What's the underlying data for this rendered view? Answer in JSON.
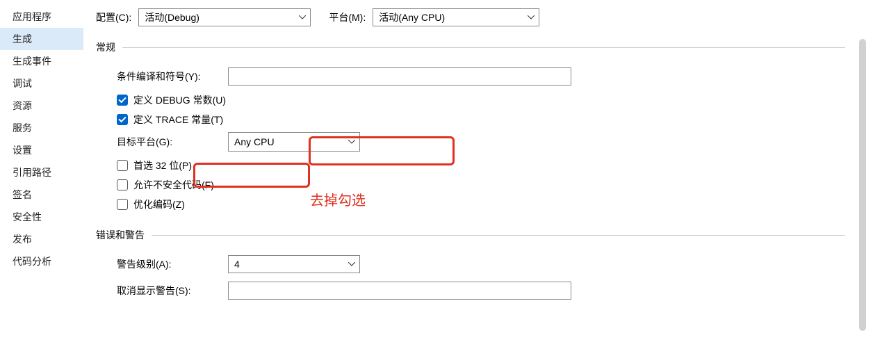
{
  "sidebar": {
    "items": [
      {
        "label": "应用程序"
      },
      {
        "label": "生成",
        "active": true
      },
      {
        "label": "生成事件"
      },
      {
        "label": "调试"
      },
      {
        "label": "资源"
      },
      {
        "label": "服务"
      },
      {
        "label": "设置"
      },
      {
        "label": "引用路径"
      },
      {
        "label": "签名"
      },
      {
        "label": "安全性"
      },
      {
        "label": "发布"
      },
      {
        "label": "代码分析"
      }
    ]
  },
  "top": {
    "config_label": "配置(C):",
    "config_value": "活动(Debug)",
    "platform_label": "平台(M):",
    "platform_value": "活动(Any CPU)"
  },
  "sections": {
    "general": {
      "legend": "常规",
      "cond_symbols_label": "条件编译和符号(Y):",
      "cond_symbols_value": "",
      "define_debug_label": "定义 DEBUG 常数(U)",
      "define_debug_checked": true,
      "define_trace_label": "定义 TRACE 常量(T)",
      "define_trace_checked": true,
      "target_platform_label": "目标平台(G):",
      "target_platform_value": "Any CPU",
      "prefer_32_label": "首选 32 位(P)",
      "prefer_32_checked": false,
      "unsafe_label": "允许不安全代码(F)",
      "unsafe_checked": false,
      "optimize_label": "优化编码(Z)",
      "optimize_checked": false
    },
    "warnings": {
      "legend": "错误和警告",
      "warn_level_label": "警告级别(A):",
      "warn_level_value": "4",
      "suppress_label": "取消显示警告(S):",
      "suppress_value": ""
    }
  },
  "annotation": "去掉勾选"
}
